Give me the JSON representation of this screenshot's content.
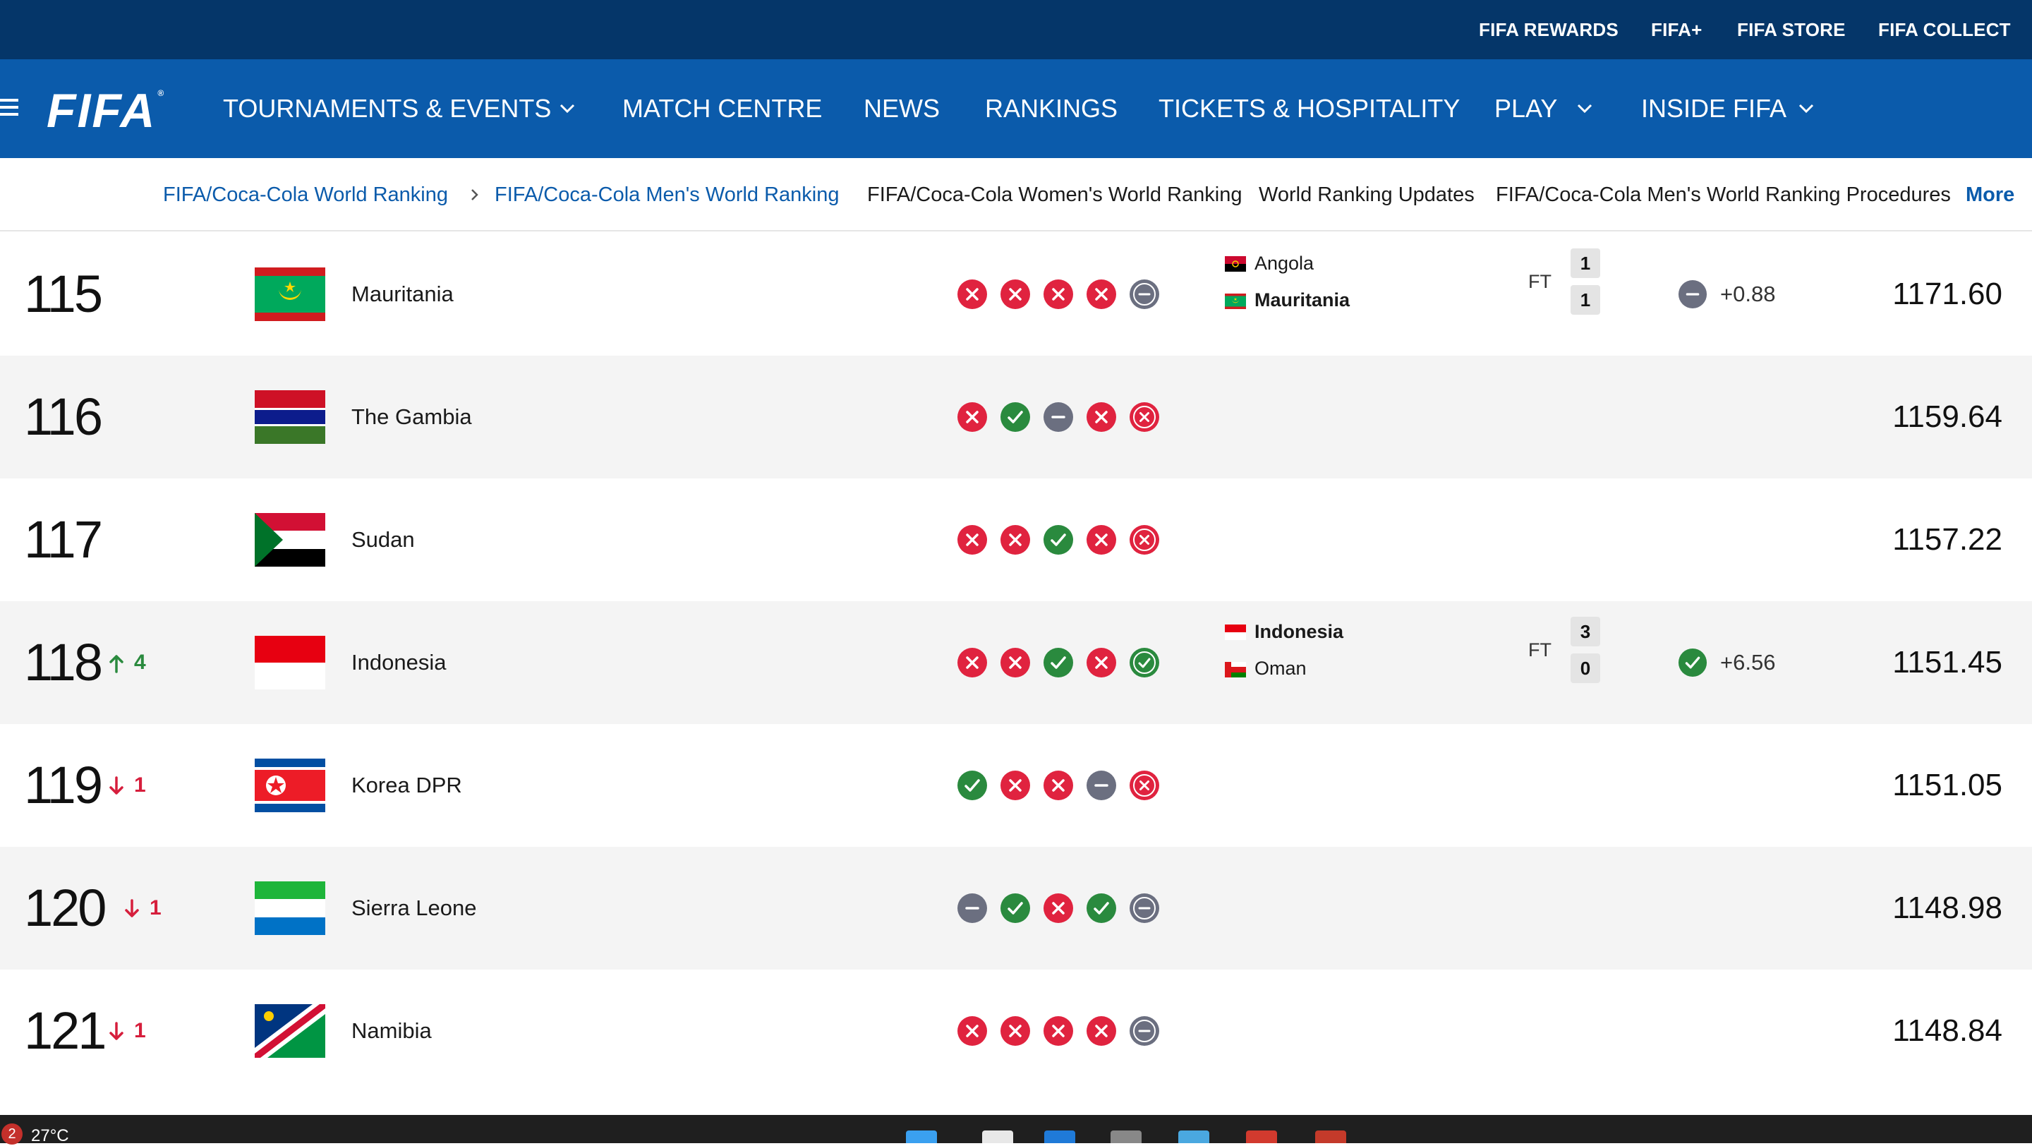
{
  "utility_links": [
    "FIFA REWARDS",
    "FIFA+",
    "FIFA STORE",
    "FIFA COLLECT"
  ],
  "logo": "FIFA",
  "nav": {
    "items": [
      "TOURNAMENTS & EVENTS",
      "MATCH CENTRE",
      "NEWS",
      "RANKINGS",
      "TICKETS & HOSPITALITY",
      "PLAY",
      "INSIDE FIFA"
    ]
  },
  "subnav": {
    "crumb1": "FIFA/Coca-Cola World Ranking",
    "crumb2": "FIFA/Coca-Cola Men's World Ranking",
    "link1": "FIFA/Coca-Cola Women's World Ranking",
    "link2": "World Ranking Updates",
    "link3": "FIFA/Coca-Cola Men's World Ranking Procedures",
    "more": "More"
  },
  "colors": {
    "util_bg": "#053669",
    "nav_bg": "#0b5bab",
    "win": "#2a8a3e",
    "loss": "#e0233f",
    "draw": "#6b6f80"
  },
  "rows": [
    {
      "rank": "115",
      "move_dir": "",
      "move_val": "",
      "team": "Mauritania",
      "flag": "mauritania",
      "form": [
        "L",
        "L",
        "L",
        "L",
        "D"
      ],
      "match": {
        "home": "Angola",
        "home_flag": "angola",
        "away": "Mauritania",
        "away_flag": "mauritania",
        "status": "FT",
        "home_score": "1",
        "away_score": "1",
        "winner": "away"
      },
      "delta_type": "draw",
      "delta": "+0.88",
      "points": "1171.60"
    },
    {
      "rank": "116",
      "move_dir": "",
      "move_val": "",
      "team": "The Gambia",
      "flag": "gambia",
      "form": [
        "L",
        "W",
        "D",
        "L",
        "L"
      ],
      "match": null,
      "delta": "",
      "points": "1159.64"
    },
    {
      "rank": "117",
      "move_dir": "",
      "move_val": "",
      "team": "Sudan",
      "flag": "sudan",
      "form": [
        "L",
        "L",
        "W",
        "L",
        "L"
      ],
      "match": null,
      "delta": "",
      "points": "1157.22"
    },
    {
      "rank": "118",
      "move_dir": "up",
      "move_val": "4",
      "team": "Indonesia",
      "flag": "indonesia",
      "form": [
        "L",
        "L",
        "W",
        "L",
        "W"
      ],
      "match": {
        "home": "Indonesia",
        "home_flag": "indonesia",
        "away": "Oman",
        "away_flag": "oman",
        "status": "FT",
        "home_score": "3",
        "away_score": "0",
        "winner": "home"
      },
      "delta_type": "win",
      "delta": "+6.56",
      "points": "1151.45"
    },
    {
      "rank": "119",
      "move_dir": "down",
      "move_val": "1",
      "team": "Korea DPR",
      "flag": "korea-dpr",
      "form": [
        "W",
        "L",
        "L",
        "D",
        "L"
      ],
      "match": null,
      "delta": "",
      "points": "1151.05"
    },
    {
      "rank": "120",
      "move_dir": "down",
      "move_val": "1",
      "team": "Sierra Leone",
      "flag": "sierra-leone",
      "form": [
        "D",
        "W",
        "L",
        "W",
        "D"
      ],
      "match": null,
      "delta": "",
      "points": "1148.98"
    },
    {
      "rank": "121",
      "move_dir": "down",
      "move_val": "1",
      "team": "Namibia",
      "flag": "namibia",
      "form": [
        "L",
        "L",
        "L",
        "L",
        "D"
      ],
      "match": null,
      "delta": "",
      "points": "1148.84"
    }
  ],
  "taskbar": {
    "badge": "2",
    "temperature": "27°C"
  }
}
